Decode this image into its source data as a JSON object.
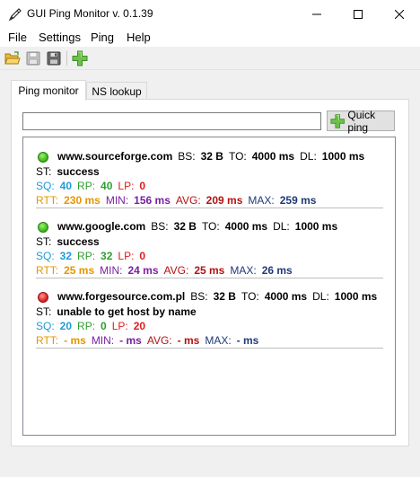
{
  "window": {
    "title": "GUI Ping Monitor v. 0.1.39",
    "icon": "pen-icon"
  },
  "menu": [
    "File",
    "Settings",
    "Ping",
    "Help"
  ],
  "toolbar": {
    "buttons": [
      "open-folder-icon",
      "save-icon",
      "save-as-icon",
      "add-icon"
    ]
  },
  "tabs": [
    "Ping monitor",
    "NS lookup"
  ],
  "active_tab": "Ping monitor",
  "search": {
    "value": "",
    "placeholder": ""
  },
  "quick_ping_label": "Quick ping",
  "labels": {
    "bs": "BS:",
    "to": "TO:",
    "dl": "DL:",
    "st": "ST:",
    "sq": "SQ:",
    "rp": "RP:",
    "lp": "LP:",
    "rtt": "RTT:",
    "min": "MIN:",
    "avg": "AVG:",
    "max": "MAX:"
  },
  "entries": [
    {
      "status": "ok",
      "host": "www.sourceforge.com",
      "bs": "32 B",
      "to": "4000  ms",
      "dl": "1000 ms",
      "st": "success",
      "sq": "40",
      "rp": "40",
      "lp": "0",
      "rtt": "230 ms",
      "min": "156 ms",
      "avg": "209 ms",
      "max": "259 ms"
    },
    {
      "status": "ok",
      "host": "www.google.com",
      "bs": "32 B",
      "to": "4000  ms",
      "dl": "1000 ms",
      "st": "success",
      "sq": "32",
      "rp": "32",
      "lp": "0",
      "rtt": "25 ms",
      "min": "24 ms",
      "avg": "25 ms",
      "max": "26 ms"
    },
    {
      "status": "error",
      "host": "www.forgesource.com.pl",
      "bs": "32 B",
      "to": "4000  ms",
      "dl": "1000 ms",
      "st": "unable to get host by name",
      "sq": "20",
      "rp": "0",
      "lp": "20",
      "rtt": "- ms",
      "min": "- ms",
      "avg": "- ms",
      "max": "- ms"
    }
  ],
  "colors": {
    "sq": "#1e9bd7",
    "rp": "#2ea02e",
    "lp": "#e01b1b",
    "rtt": "#e59500",
    "min": "#7a1fa2",
    "avg": "#b31212",
    "max": "#1f3a7a"
  }
}
